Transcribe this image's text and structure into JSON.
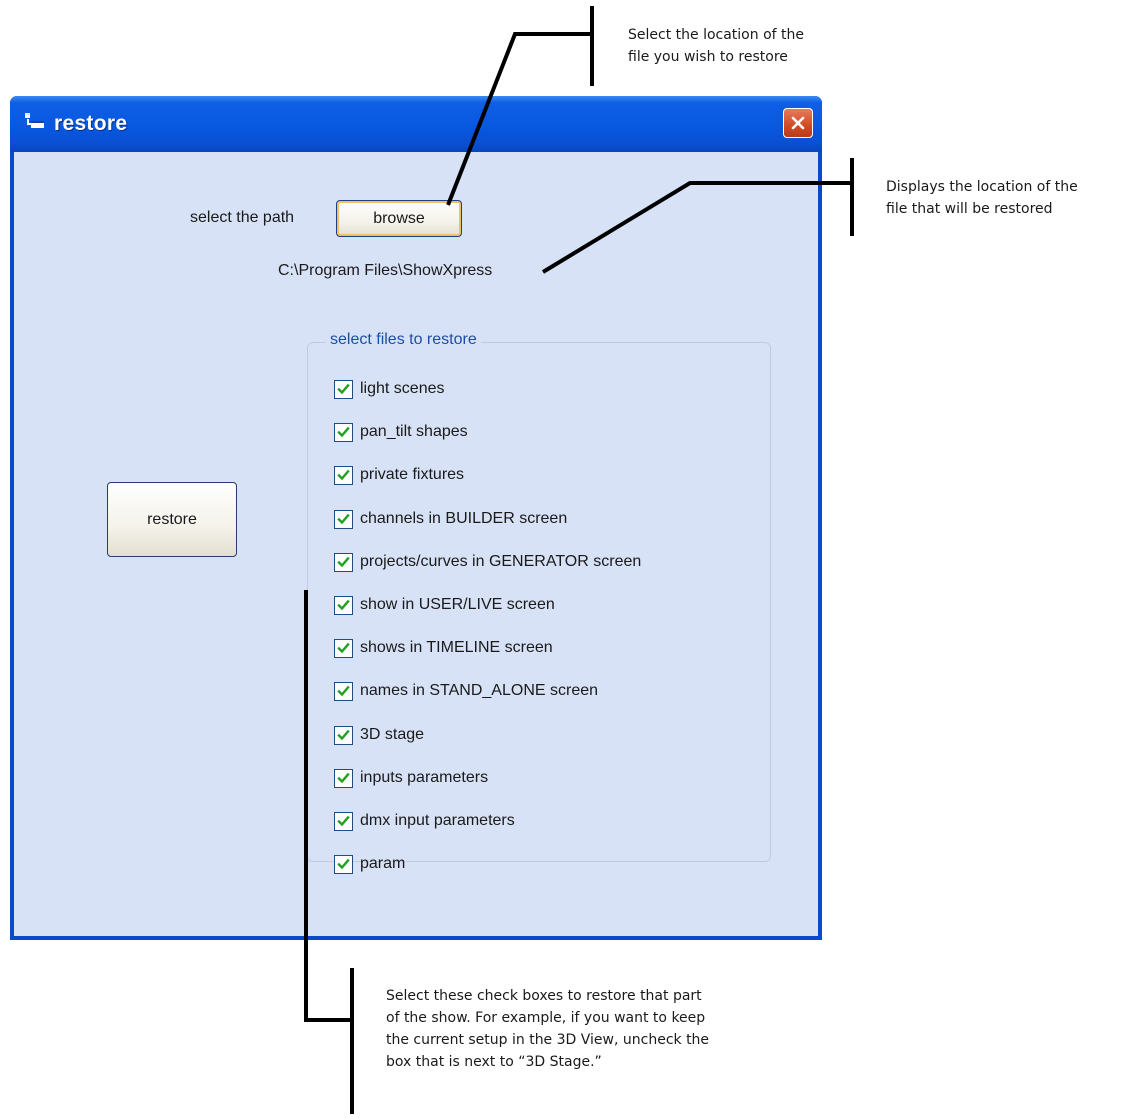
{
  "window": {
    "title": "restore",
    "app_icon": "window-icon",
    "close_icon": "close-icon"
  },
  "path_section": {
    "label": "select the path",
    "browse_label": "browse",
    "path_value": "C:\\Program Files\\ShowXpress"
  },
  "restore_button": {
    "label": "restore"
  },
  "files_group": {
    "title": "select files to restore",
    "items": [
      {
        "label": "light scenes",
        "checked": true
      },
      {
        "label": "pan_tilt shapes",
        "checked": true
      },
      {
        "label": "private fixtures",
        "checked": true
      },
      {
        "label": "channels in BUILDER screen",
        "checked": true
      },
      {
        "label": "projects/curves in GENERATOR screen",
        "checked": true
      },
      {
        "label": "show in USER/LIVE screen",
        "checked": true
      },
      {
        "label": "shows in TIMELINE screen",
        "checked": true
      },
      {
        "label": "names in STAND_ALONE screen",
        "checked": true
      },
      {
        "label": "3D stage",
        "checked": true
      },
      {
        "label": "inputs parameters",
        "checked": true
      },
      {
        "label": "dmx input parameters",
        "checked": true
      },
      {
        "label": "param",
        "checked": true
      }
    ]
  },
  "annotations": {
    "browse": {
      "line1": "Select the location of the",
      "line2": "file you wish to restore"
    },
    "path": {
      "line1": "Displays the location of the",
      "line2": "file that will be restored"
    },
    "checkboxes": {
      "line1": "Select these check boxes to restore that part",
      "line2": "of the show. For example, if you want to keep",
      "line3": "the current setup in the 3D View, uncheck the",
      "line4": "box that is next to “3D Stage.”"
    }
  },
  "colors": {
    "titlebar": "#0858e0",
    "client_bg": "#d7e2f6",
    "group_title": "#1d4ea6",
    "check": "#21a121",
    "close": "#d24a24"
  }
}
